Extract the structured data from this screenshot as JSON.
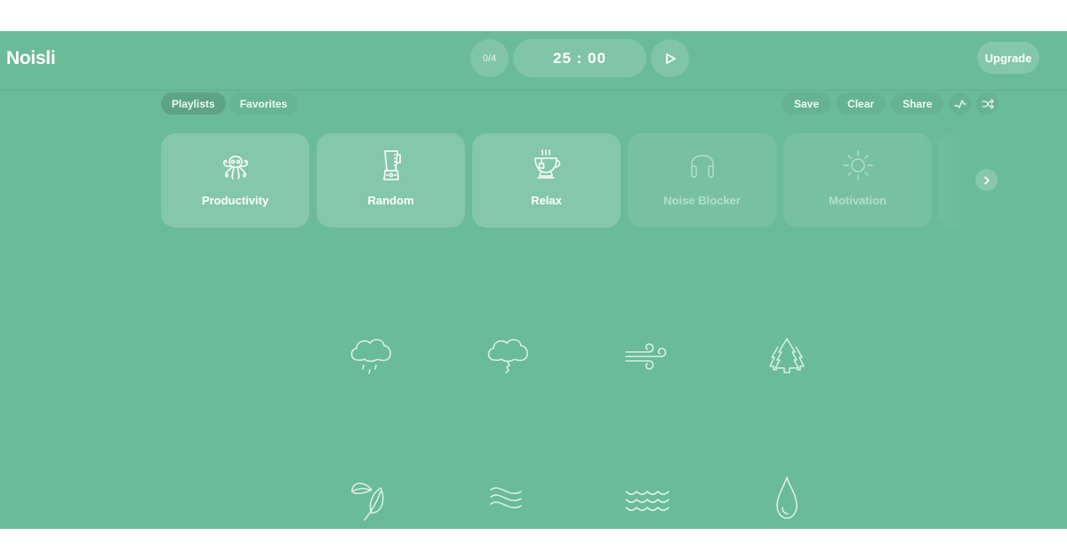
{
  "header": {
    "logo": "Noisli",
    "timer": {
      "counter": "0/4",
      "time": "25 : 00",
      "play_icon": "play-icon"
    },
    "upgrade_label": "Upgrade"
  },
  "toolbar": {
    "tabs": [
      {
        "label": "Playlists",
        "active": true
      },
      {
        "label": "Favorites",
        "active": false
      }
    ],
    "actions": [
      {
        "label": "Save"
      },
      {
        "label": "Clear"
      },
      {
        "label": "Share"
      }
    ],
    "icon_actions": [
      "timer-wave-icon",
      "shuffle-icon"
    ]
  },
  "playlists": [
    {
      "label": "Productivity",
      "icon": "octopus-icon",
      "enabled": true
    },
    {
      "label": "Random",
      "icon": "blender-icon",
      "enabled": true
    },
    {
      "label": "Relax",
      "icon": "teacup-icon",
      "enabled": true
    },
    {
      "label": "Noise Blocker",
      "icon": "headphones-icon",
      "enabled": false
    },
    {
      "label": "Motivation",
      "icon": "sun-icon",
      "enabled": false
    }
  ],
  "sounds": [
    {
      "name": "Rain",
      "icon": "rain-cloud-icon"
    },
    {
      "name": "Thunderstorm",
      "icon": "thunder-cloud-icon"
    },
    {
      "name": "Wind",
      "icon": "wind-icon"
    },
    {
      "name": "Forest",
      "icon": "forest-icon"
    },
    {
      "name": "Leaves",
      "icon": "leaves-icon"
    },
    {
      "name": "Water Stream",
      "icon": "stream-icon"
    },
    {
      "name": "Seaside",
      "icon": "waves-icon"
    },
    {
      "name": "Water",
      "icon": "water-drop-icon"
    }
  ],
  "colors": {
    "background": "#6abb98",
    "foreground": "#ffffff"
  }
}
